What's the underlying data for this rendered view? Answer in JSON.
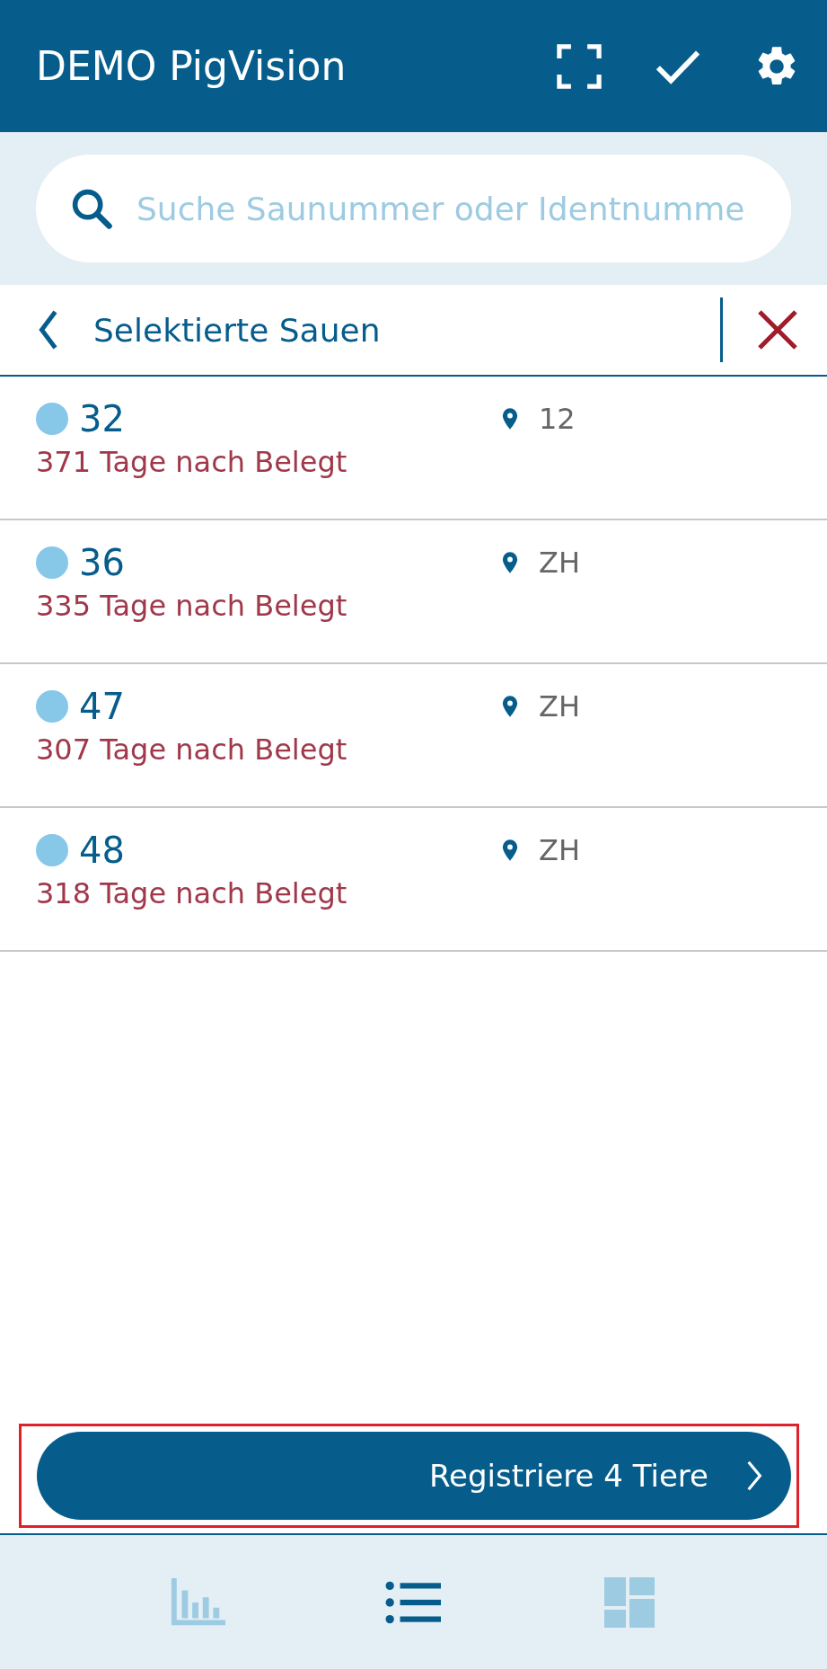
{
  "header": {
    "title": "DEMO PigVision"
  },
  "search": {
    "placeholder": "Suche Saunummer oder Identnumme"
  },
  "selection_bar": {
    "title": "Selektierte Sauen"
  },
  "rows": [
    {
      "number": "32",
      "location": "12",
      "status": "371 Tage nach Belegt"
    },
    {
      "number": "36",
      "location": "ZH",
      "status": "335 Tage nach Belegt"
    },
    {
      "number": "47",
      "location": "ZH",
      "status": "307 Tage nach Belegt"
    },
    {
      "number": "48",
      "location": "ZH",
      "status": "318 Tage nach Belegt"
    }
  ],
  "action_button": {
    "label": "Registriere 4 Tiere"
  },
  "bottom_nav": [
    {
      "kind": "chart",
      "selected": false
    },
    {
      "kind": "list",
      "selected": true
    },
    {
      "kind": "dashboard",
      "selected": false
    }
  ]
}
